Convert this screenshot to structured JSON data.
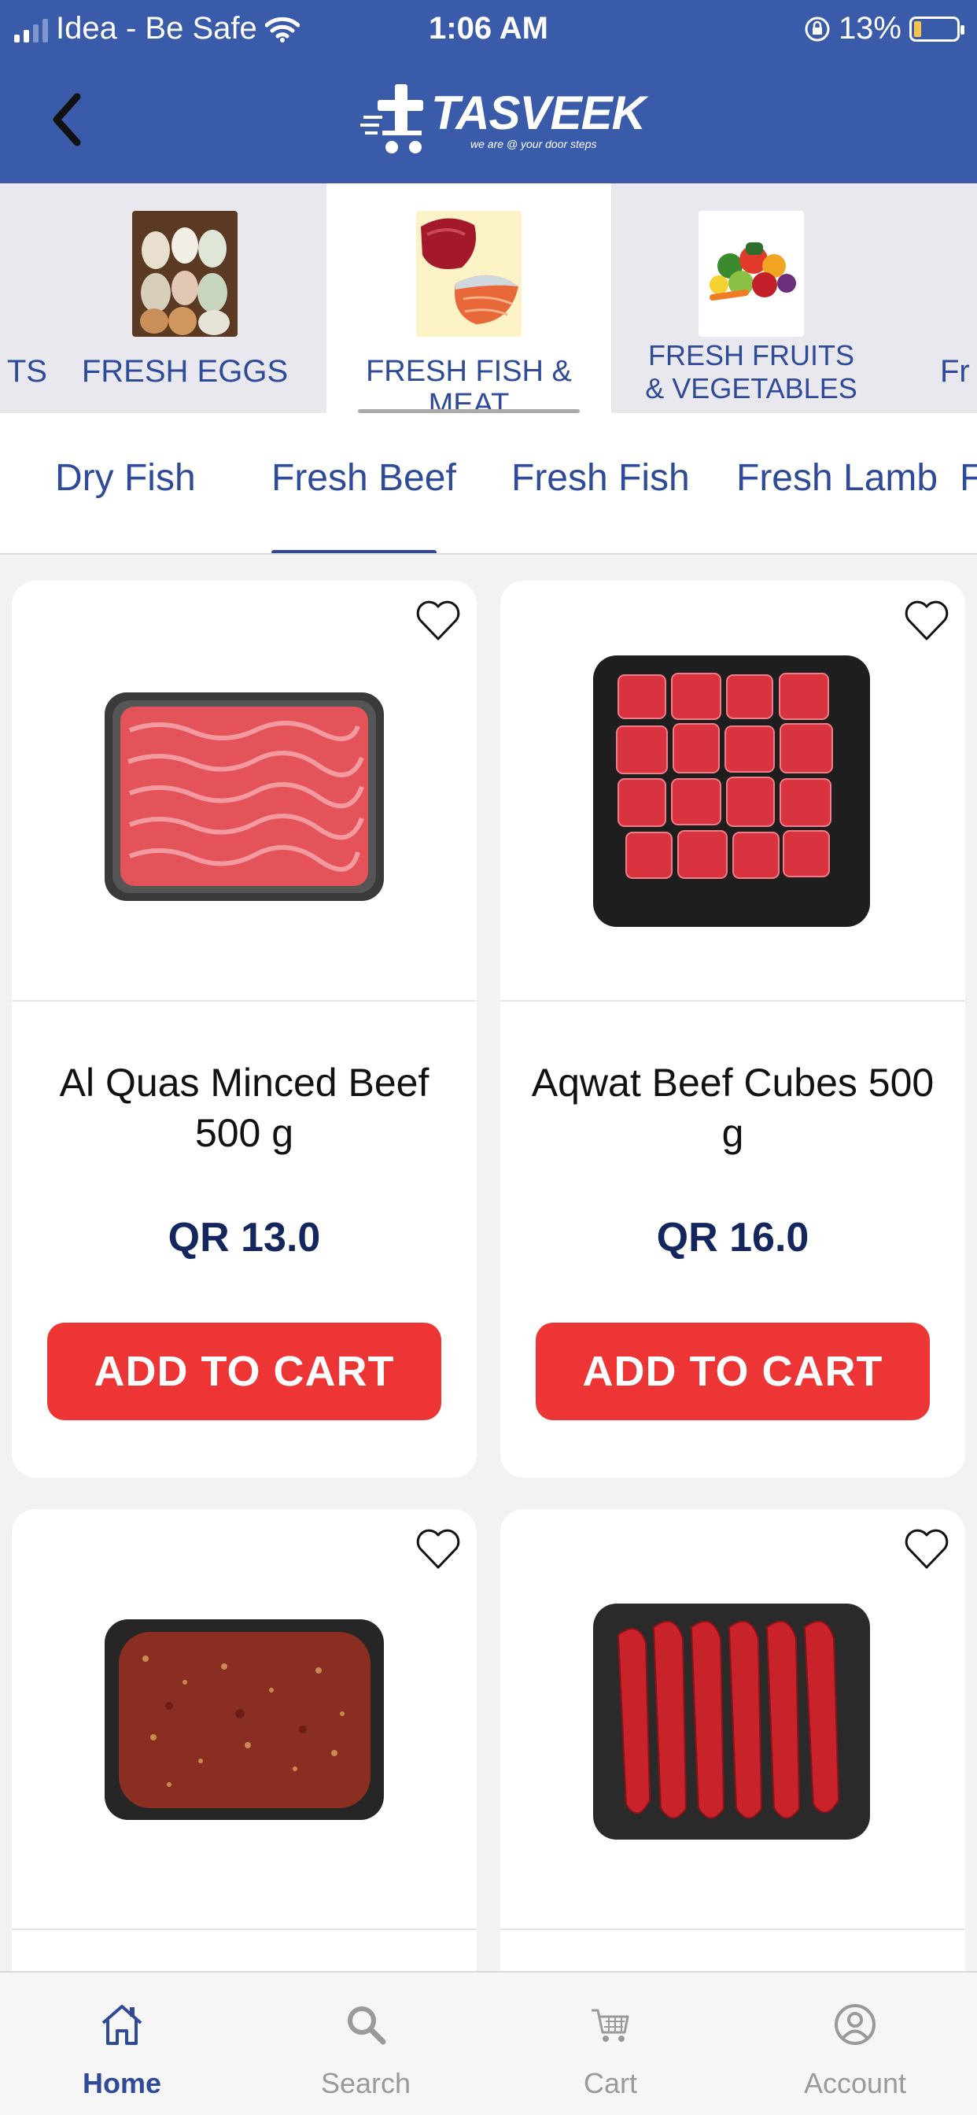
{
  "status_bar": {
    "carrier": "Idea - Be Safe",
    "time": "1:06 AM",
    "battery": "13%"
  },
  "header": {
    "logo_name": "TASVEEK",
    "logo_tagline": "we are @ your door steps"
  },
  "categories": [
    {
      "label": "TS",
      "active": false
    },
    {
      "label": "FRESH EGGS",
      "active": false
    },
    {
      "label": "FRESH FISH & MEAT",
      "active": true
    },
    {
      "label_line1": "FRESH FRUITS",
      "label_line2": "& VEGETABLES",
      "active": false
    },
    {
      "label": "Fr",
      "active": false
    }
  ],
  "subtabs": [
    "Dry Fish",
    "Fresh Beef",
    "Fresh Fish",
    "Fresh Lamb",
    "F"
  ],
  "active_subtab": "Fresh Beef",
  "products": [
    {
      "title_line1": "Al Quas Minced Beef",
      "title_line2": "500 g",
      "price": "QR 13.0",
      "button": "ADD TO CART"
    },
    {
      "title_line1": "Aqwat Beef Cubes 500 g",
      "title_line2": "",
      "price": "QR 16.0",
      "button": "ADD TO CART"
    },
    {
      "title_line1": "",
      "title_line2": "",
      "price": "",
      "button": ""
    },
    {
      "title_line1": "",
      "title_line2": "",
      "price": "",
      "button": ""
    }
  ],
  "bottom_nav": [
    {
      "label": "Home",
      "icon": "home-icon",
      "active": true
    },
    {
      "label": "Search",
      "icon": "search-icon",
      "active": false
    },
    {
      "label": "Cart",
      "icon": "cart-icon",
      "active": false
    },
    {
      "label": "Account",
      "icon": "account-icon",
      "active": false
    }
  ],
  "colors": {
    "header_blue": "#3a5ba9",
    "text_blue": "#2e4a98",
    "price_navy": "#13275e",
    "button_red": "#ee3535"
  }
}
